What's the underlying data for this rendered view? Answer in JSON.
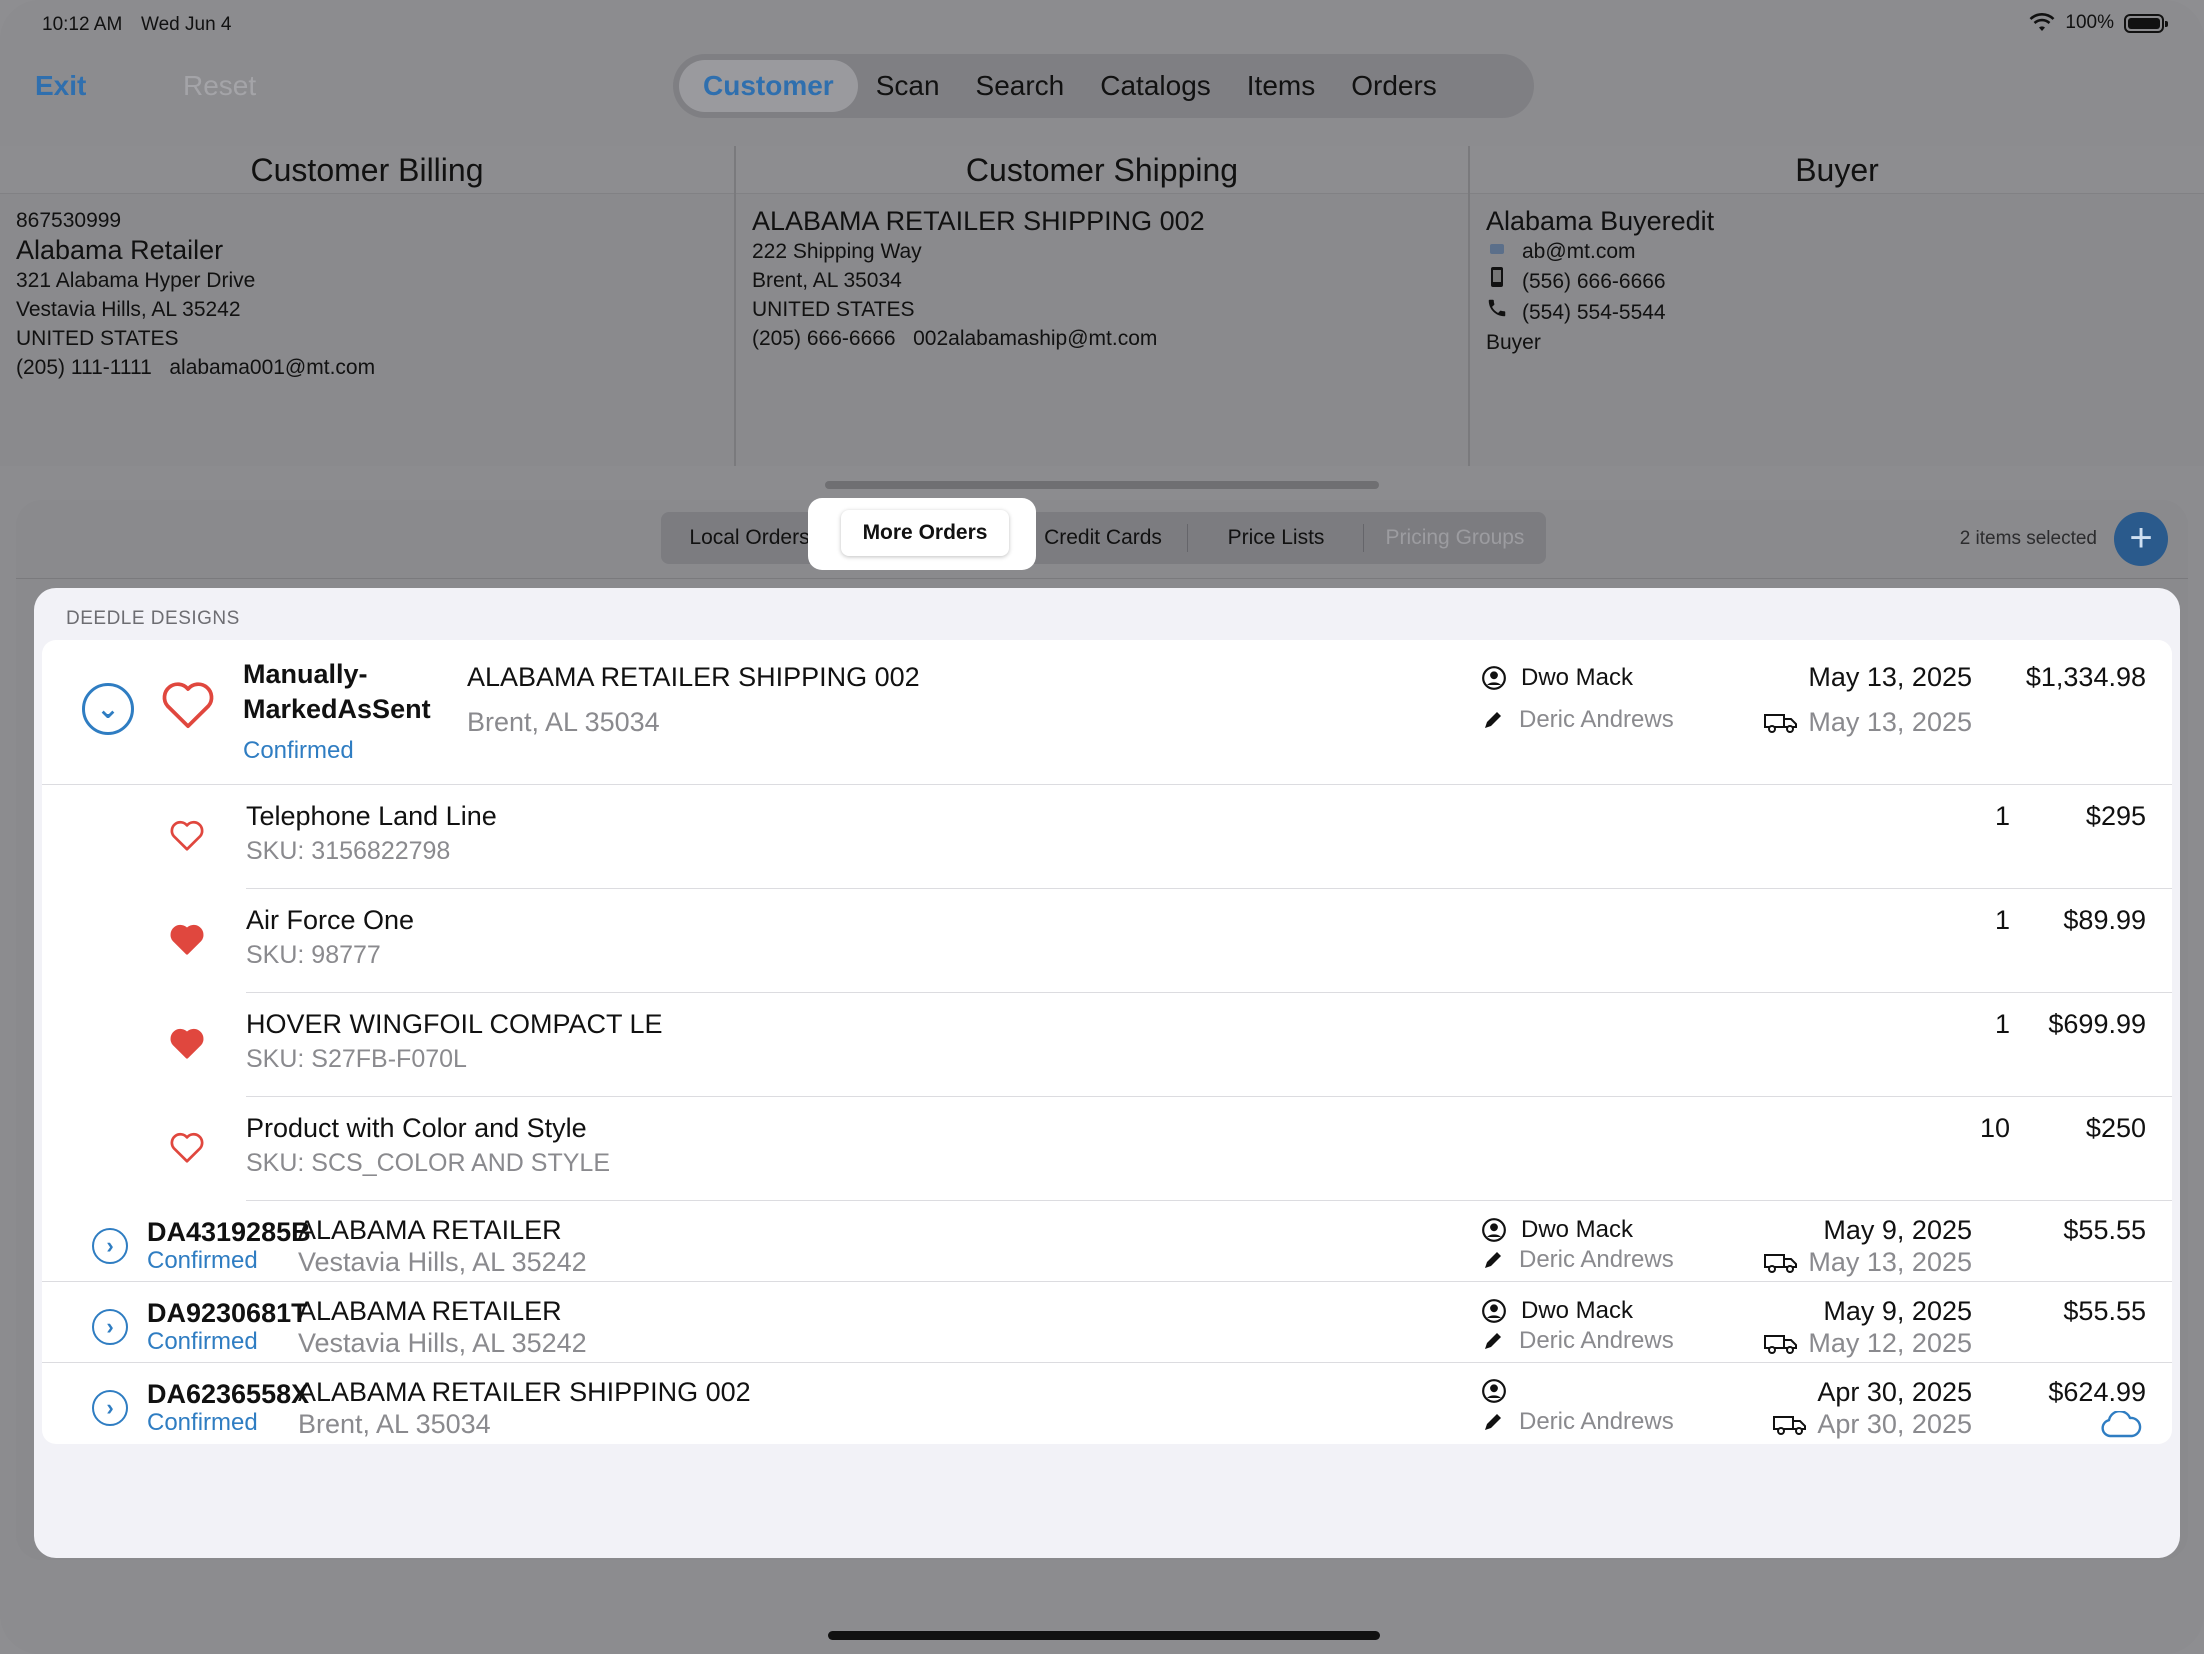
{
  "status_bar": {
    "time": "10:12 AM",
    "date": "Wed Jun 4",
    "battery": "100%"
  },
  "nav": {
    "exit": "Exit",
    "reset": "Reset",
    "tabs": [
      "Customer",
      "Scan",
      "Search",
      "Catalogs",
      "Items",
      "Orders"
    ],
    "active_tab": "Customer"
  },
  "billing": {
    "title": "Customer Billing",
    "account": "867530999",
    "name": "Alabama Retailer",
    "street": "321 Alabama Hyper Drive",
    "city": "Vestavia Hills, AL  35242",
    "country": "UNITED STATES",
    "phone": "(205) 111-1111",
    "email": "alabama001@mt.com"
  },
  "shipping": {
    "title": "Customer Shipping",
    "name": "ALABAMA RETAILER SHIPPING 002",
    "street": "222 Shipping Way",
    "city": "Brent, AL  35034",
    "country": "UNITED STATES",
    "phone": "(205) 666-6666",
    "email": "002alabamaship@mt.com"
  },
  "buyer": {
    "title": "Buyer",
    "name": "Alabama Buyeredit",
    "email": "ab@mt.com",
    "mobile": "(556) 666-6666",
    "phone": "(554) 554-5544",
    "role": "Buyer"
  },
  "subtabs": {
    "items": [
      "Local Orders",
      "More Orders",
      "Credit Cards",
      "Price Lists",
      "Pricing Groups"
    ],
    "active": "More Orders",
    "selected_count": "2 items selected"
  },
  "group_title": "DEEDLE DESIGNS",
  "orders": [
    {
      "id": "Manually-\nMarkedAsSent",
      "id_line1": "Manually-",
      "id_line2": "MarkedAsSent",
      "status": "Confirmed",
      "ship_name": "ALABAMA RETAILER SHIPPING 002",
      "ship_city": "Brent, AL  35034",
      "customer_rep": "Dwo Mack",
      "entered_by": "Deric Andrews",
      "order_date": "May 13, 2025",
      "ship_date": "May 13, 2025",
      "total": "$1,334.98",
      "items": [
        {
          "name": "Telephone Land Line",
          "sku": "SKU: 3156822798",
          "qty": "1",
          "price": "$295",
          "favorite": false
        },
        {
          "name": "Air Force One",
          "sku": "SKU: 98777",
          "qty": "1",
          "price": "$89.99",
          "favorite": true
        },
        {
          "name": "HOVER WINGFOIL COMPACT LE",
          "sku": "SKU: S27FB-F070L",
          "qty": "1",
          "price": "$699.99",
          "favorite": true
        },
        {
          "name": "Product with Color and Style",
          "sku": "SKU: SCS_COLOR AND STYLE",
          "qty": "10",
          "price": "$250",
          "favorite": false
        }
      ]
    },
    {
      "id": "DA4319285B",
      "status": "Confirmed",
      "ship_name": "ALABAMA RETAILER",
      "ship_city": "Vestavia Hills, AL  35242",
      "customer_rep": "Dwo Mack",
      "entered_by": "Deric Andrews",
      "order_date": "May 9, 2025",
      "ship_date": "May 13, 2025",
      "total": "$55.55"
    },
    {
      "id": "DA9230681T",
      "status": "Confirmed",
      "ship_name": "ALABAMA RETAILER",
      "ship_city": "Vestavia Hills, AL  35242",
      "customer_rep": "Dwo Mack",
      "entered_by": "Deric Andrews",
      "order_date": "May 9, 2025",
      "ship_date": "May 12, 2025",
      "total": "$55.55"
    },
    {
      "id": "DA6236558X",
      "status": "Confirmed",
      "ship_name": "ALABAMA RETAILER SHIPPING 002",
      "ship_city": "Brent, AL  35034",
      "customer_rep": "",
      "entered_by": "Deric Andrews",
      "order_date": "Apr 30, 2025",
      "ship_date": "Apr 30, 2025",
      "total": "$624.99"
    }
  ],
  "colors": {
    "accent": "#2f7dc2",
    "heart": "#e0473e",
    "dim_background": "#8c8c8f"
  },
  "icons": {
    "rep": "person-circle-icon",
    "entered_by": "pencil-icon",
    "ship": "truck-icon",
    "cloud": "cloud-icon",
    "expand": "chevron-circle-icon"
  }
}
